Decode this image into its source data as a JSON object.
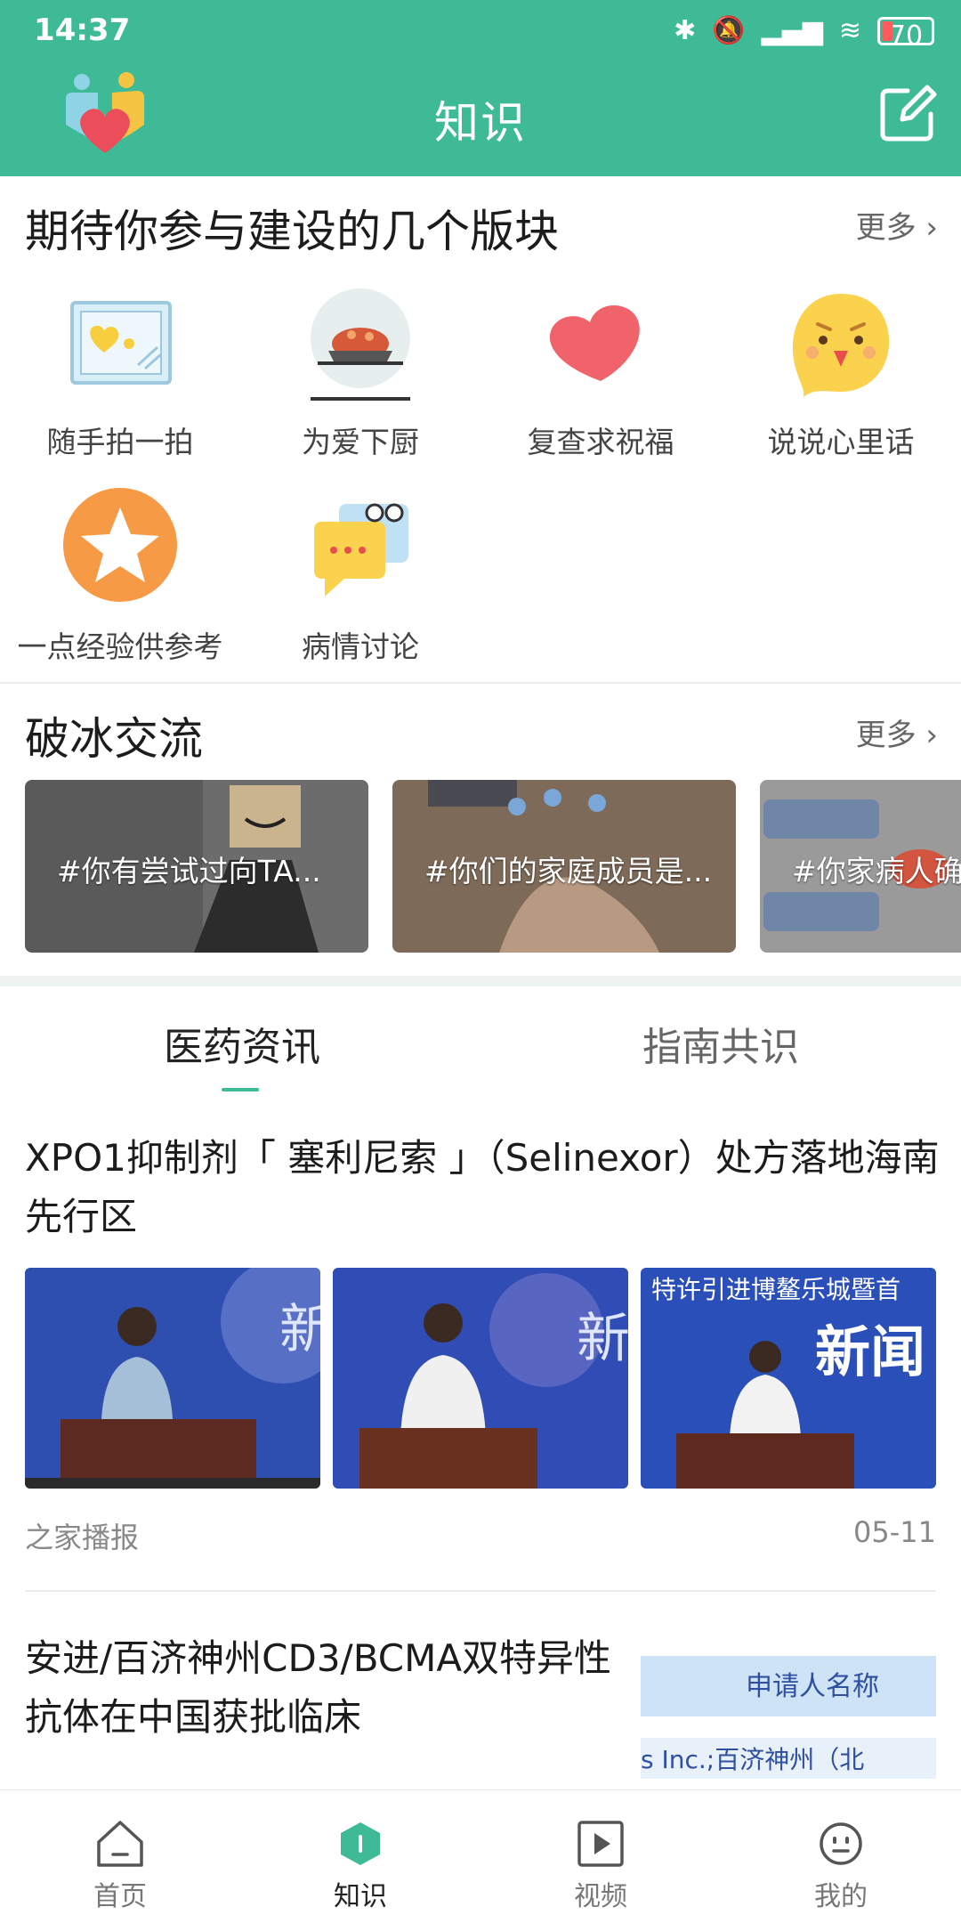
{
  "status_bar": {
    "time": "14:37",
    "battery": "70"
  },
  "header": {
    "title": "知识"
  },
  "section1": {
    "title": "期待你参与建设的几个版块",
    "more": "更多",
    "items": [
      {
        "label": "随手拍一拍",
        "icon": "photo-frame-icon"
      },
      {
        "label": "为爱下厨",
        "icon": "cooking-icon"
      },
      {
        "label": "复查求祝福",
        "icon": "heart-icon"
      },
      {
        "label": "说说心里话",
        "icon": "smiley-face-icon"
      },
      {
        "label": "一点经验供参考",
        "icon": "star-icon"
      },
      {
        "label": "病情讨论",
        "icon": "chat-bubble-icon"
      }
    ]
  },
  "section2": {
    "title": "破冰交流",
    "more": "更多",
    "cards": [
      {
        "caption": "#你有尝试过向TA..."
      },
      {
        "caption": "#你们的家庭成员是..."
      },
      {
        "caption": "#你家病人确"
      }
    ]
  },
  "tabs": [
    {
      "label": "医药资讯",
      "active": true
    },
    {
      "label": "指南共识",
      "active": false
    }
  ],
  "articles": [
    {
      "title": "XPO1抑制剂「 塞利尼索 」（Selinexor）处方落地海南先行区",
      "thumb_texts": [
        "新",
        "新",
        "特许引进博鳌乐城暨首",
        "新闻"
      ],
      "source": "之家播报",
      "date": "05-11"
    },
    {
      "title": "安进/百济神州CD3/BCMA双特异性抗体在中国获批临床",
      "thumb_texts": [
        "申请人名称",
        "s Inc.;百济神州（北"
      ]
    }
  ],
  "bottom_nav": [
    {
      "label": "首页",
      "icon": "home-icon",
      "active": false
    },
    {
      "label": "知识",
      "icon": "knowledge-icon",
      "active": true
    },
    {
      "label": "视频",
      "icon": "video-icon",
      "active": false
    },
    {
      "label": "我的",
      "icon": "profile-icon",
      "active": false
    }
  ],
  "colors": {
    "accent": "#3fba97",
    "heart": "#f0636a",
    "star_bg": "#f79a45"
  }
}
